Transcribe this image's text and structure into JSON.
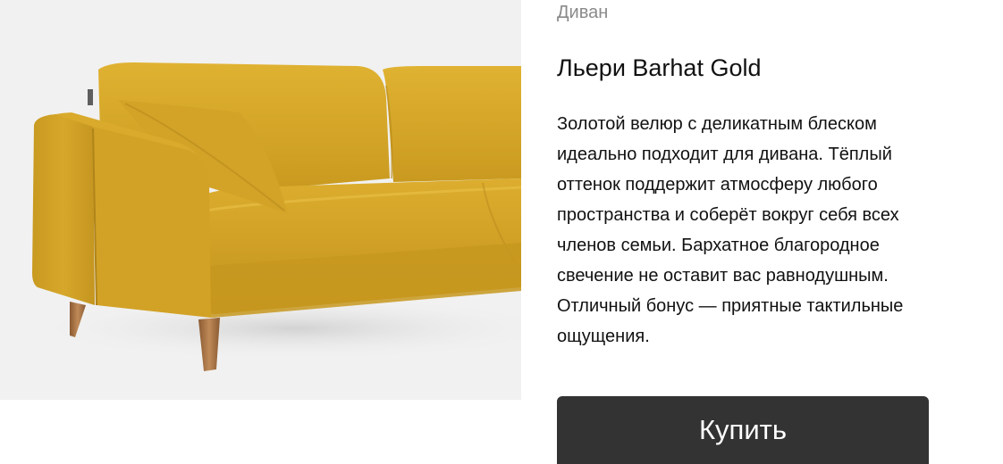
{
  "product": {
    "image_subject": "sofa",
    "category": "Диван",
    "name": "Льери Barhat Gold",
    "description_lines": [
      "Золотой велюр с деликатным блеском",
      "идеально подходит для дивана. Тёплый",
      "оттенок поддержит атмосферу любого",
      "пространства и соберёт вокруг себя всех",
      "членов семьи. Бархатное благородное",
      "свечение не оставит вас равнодушным.",
      "Отличный бонус — приятные тактильные",
      "ощущения."
    ],
    "buy_label": "Купить"
  },
  "colors": {
    "upholstery": "#d9a82a",
    "upholstery_shadow": "#b88a1c",
    "leg": "#b07a4a",
    "button_bg": "#333333",
    "category_text": "#8a8a8a"
  }
}
